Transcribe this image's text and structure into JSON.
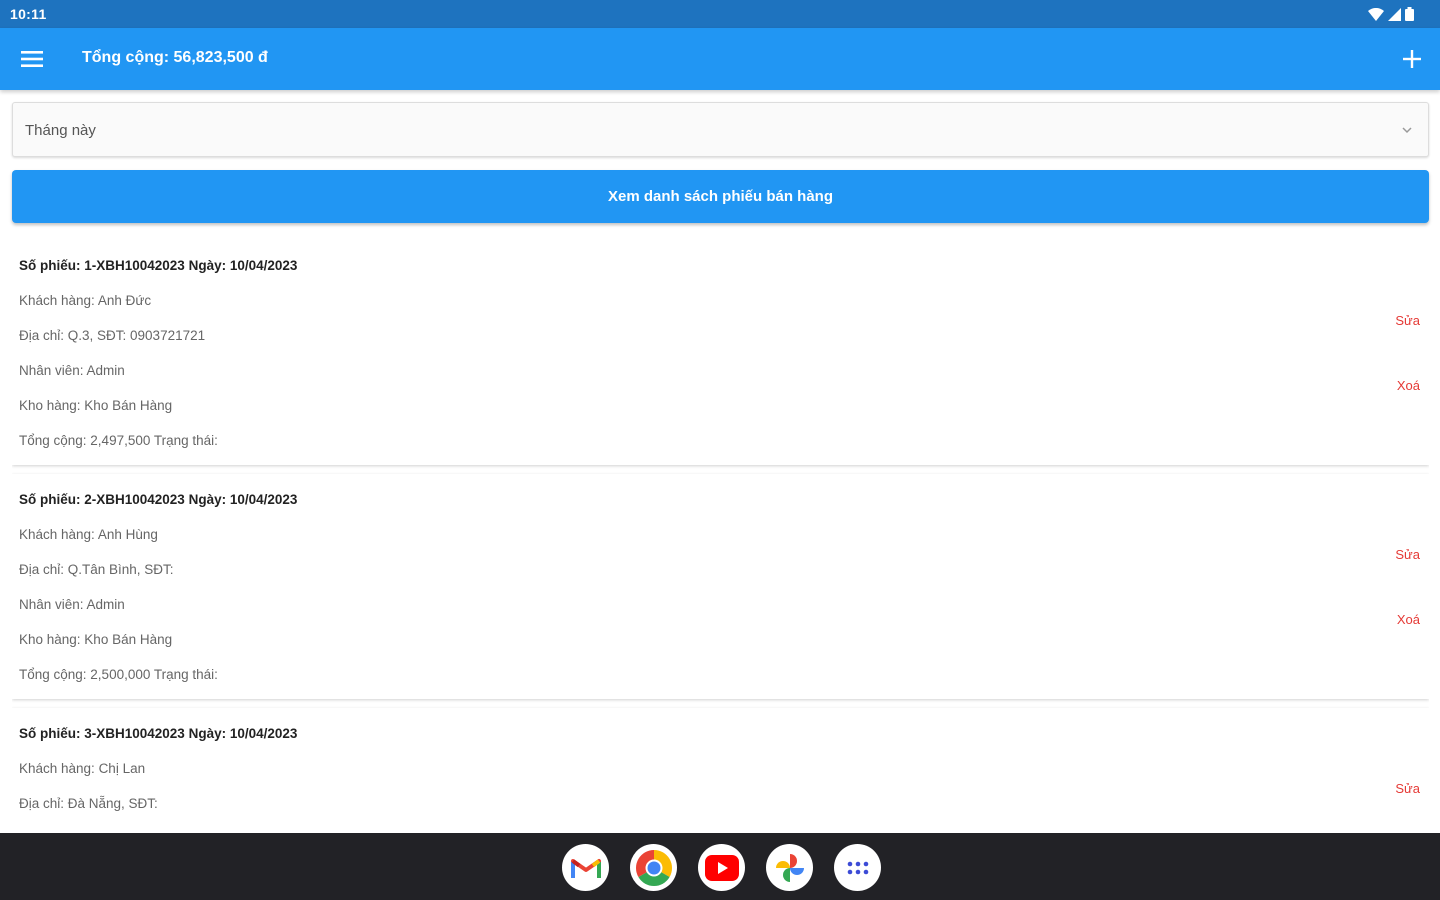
{
  "status_bar": {
    "time": "10:11"
  },
  "app_bar": {
    "title": "Tổng cộng: 56,823,500 đ"
  },
  "filter": {
    "selected": "Tháng này"
  },
  "view_button": {
    "label": "Xem danh sách phiếu bán hàng"
  },
  "orders": [
    {
      "header": "Số phiếu: 1-XBH10042023 Ngày: 10/04/2023",
      "customer": "Khách hàng: Anh Đức",
      "address": "Địa chỉ: Q.3, SĐT: 0903721721",
      "staff": "Nhân viên: Admin",
      "warehouse": "Kho hàng: Kho Bán Hàng",
      "total": "Tổng cộng: 2,497,500 Trạng thái:",
      "edit_label": "Sửa",
      "delete_label": "Xoá"
    },
    {
      "header": "Số phiếu: 2-XBH10042023 Ngày: 10/04/2023",
      "customer": "Khách hàng: Anh Hùng",
      "address": "Địa chỉ: Q.Tân Bình, SĐT:",
      "staff": "Nhân viên: Admin",
      "warehouse": "Kho hàng: Kho Bán Hàng",
      "total": "Tổng cộng: 2,500,000 Trạng thái:",
      "edit_label": "Sửa",
      "delete_label": "Xoá"
    },
    {
      "header": "Số phiếu: 3-XBH10042023 Ngày: 10/04/2023",
      "customer": "Khách hàng: Chị Lan",
      "address": "Địa chỉ: Đà Nẵng, SĐT:",
      "edit_label": "Sửa"
    }
  ],
  "dock": [
    "gmail-icon",
    "chrome-icon",
    "youtube-icon",
    "photos-icon",
    "app-drawer-icon"
  ],
  "colors": {
    "primary": "#2196f3",
    "status_bar": "#1e73bf",
    "danger": "#e53935",
    "nav_bar": "#222226"
  }
}
